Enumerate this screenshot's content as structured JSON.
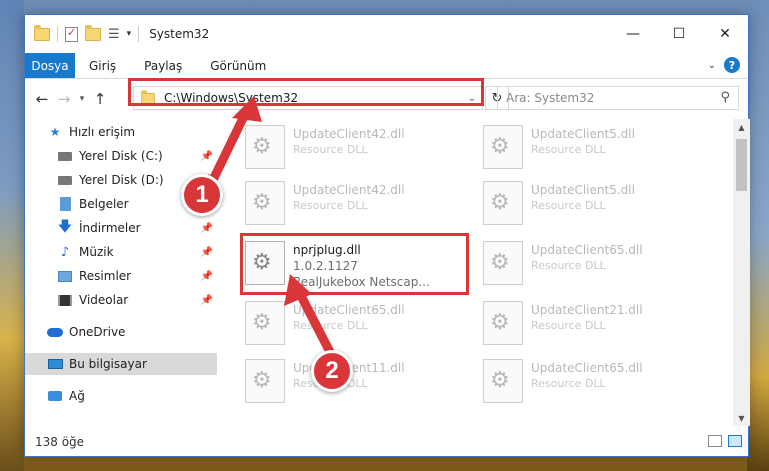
{
  "window": {
    "title": "System32"
  },
  "ribbon": {
    "tabs": [
      "Dosya",
      "Giriş",
      "Paylaş",
      "Görünüm"
    ]
  },
  "address": {
    "path": "C:\\Windows\\System32",
    "search_placeholder": "Ara: System32"
  },
  "sidebar": {
    "items": [
      {
        "label": "Hızlı erişim",
        "icon": "star-icon"
      },
      {
        "label": "Yerel Disk (C:)",
        "icon": "disk-icon"
      },
      {
        "label": "Yerel Disk (D:)",
        "icon": "disk-icon"
      },
      {
        "label": "Belgeler",
        "icon": "documents-icon"
      },
      {
        "label": "İndirmeler",
        "icon": "download-icon"
      },
      {
        "label": "Müzik",
        "icon": "music-icon"
      },
      {
        "label": "Resimler",
        "icon": "pictures-icon"
      },
      {
        "label": "Videolar",
        "icon": "video-icon"
      },
      {
        "label": "OneDrive",
        "icon": "cloud-icon"
      },
      {
        "label": "Bu bilgisayar",
        "icon": "computer-icon"
      },
      {
        "label": "Ağ",
        "icon": "network-icon"
      }
    ]
  },
  "files": [
    {
      "name": "UpdateClient42.dll",
      "desc": "Resource DLL"
    },
    {
      "name": "UpdateClient5.dll",
      "desc": "Resource DLL"
    },
    {
      "name": "UpdateClient42.dll",
      "desc": "Resource DLL"
    },
    {
      "name": "UpdateClient5.dll",
      "desc": "Resource DLL"
    },
    {
      "name": "UpdateClient65.dll",
      "desc": "Resource DLL"
    },
    {
      "name": "UpdateClient65.dll",
      "desc": "Resource DLL"
    },
    {
      "name": "UpdateClient21.dll",
      "desc": "Resource DLL"
    },
    {
      "name": "UpdateClient11.dll",
      "desc": "Resource DLL"
    },
    {
      "name": "UpdateClient65.dll",
      "desc": "Resource DLL"
    }
  ],
  "focus_file": {
    "name": "nprjplug.dll",
    "version": "1.0.2.1127",
    "description": "RealJukebox Netscap..."
  },
  "status": {
    "count": "138 öğe"
  },
  "callouts": [
    "1",
    "2"
  ],
  "colors": {
    "accent": "#1979ca",
    "highlight": "#d9363a"
  }
}
